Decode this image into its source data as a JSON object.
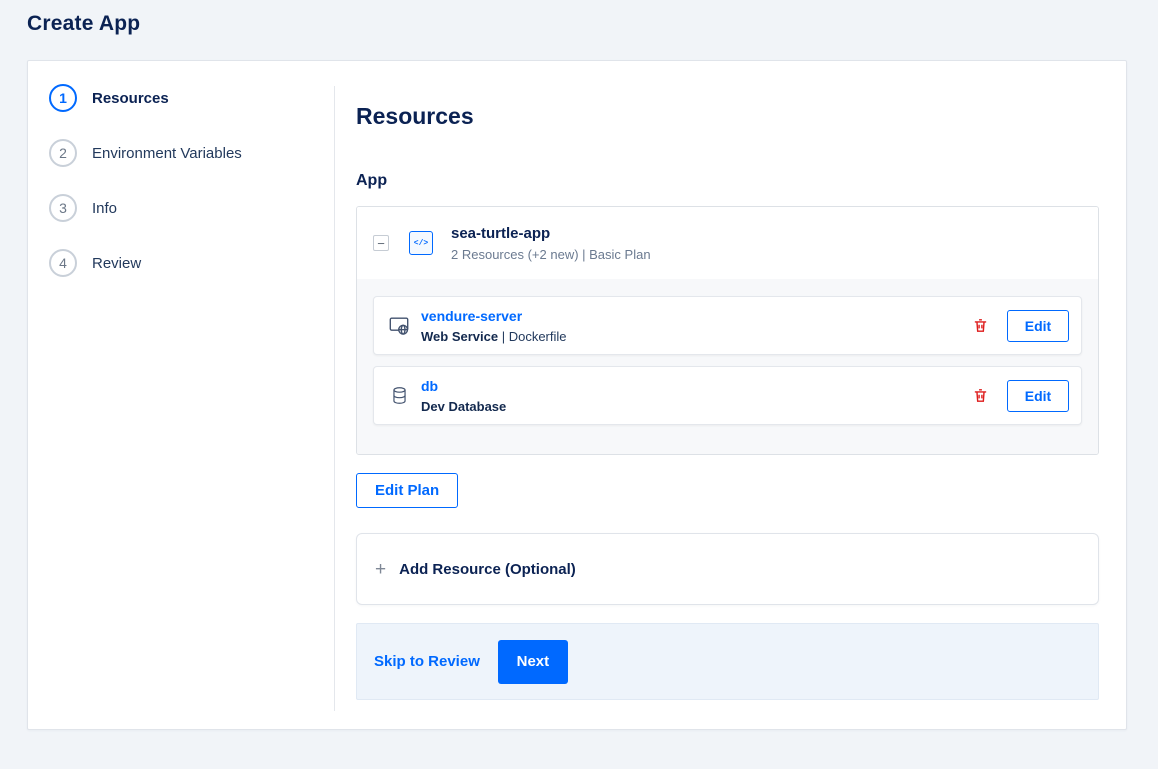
{
  "page": {
    "title": "Create App"
  },
  "stepper": {
    "steps": [
      {
        "number": "1",
        "label": "Resources",
        "active": true
      },
      {
        "number": "2",
        "label": "Environment Variables",
        "active": false
      },
      {
        "number": "3",
        "label": "Info",
        "active": false
      },
      {
        "number": "4",
        "label": "Review",
        "active": false
      }
    ]
  },
  "content": {
    "heading": "Resources",
    "section_label": "App",
    "app_card": {
      "name": "sea-turtle-app",
      "subtitle": "2 Resources (+2 new) | Basic Plan",
      "resources": [
        {
          "name": "vendure-server",
          "type": "Web Service",
          "detail": " | Dockerfile",
          "icon": "web-service-icon",
          "edit_label": "Edit"
        },
        {
          "name": "db",
          "type": "Dev Database",
          "detail": "",
          "icon": "database-icon",
          "edit_label": "Edit"
        }
      ]
    },
    "edit_plan_label": "Edit Plan",
    "add_resource_label": "Add Resource (Optional)",
    "footer": {
      "skip_label": "Skip to Review",
      "next_label": "Next"
    }
  },
  "icons": {
    "collapse_glyph": "−",
    "add_glyph": "+",
    "app_badge_glyph": "</>"
  },
  "colors": {
    "accent": "#0069ff",
    "danger": "#de1b1b",
    "text_dark": "#0b2253",
    "text_gray": "#6b7a90",
    "footer_bg": "#eef4fb"
  }
}
